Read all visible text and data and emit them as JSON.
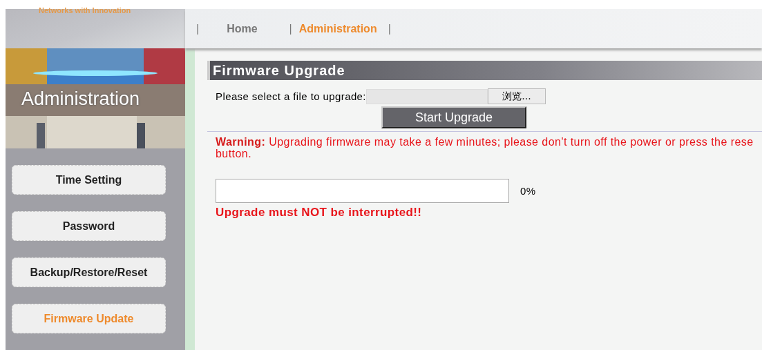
{
  "logo": {
    "tagline": "Networks with Innovation"
  },
  "nav": {
    "separator": "|",
    "items": [
      {
        "label": "Home",
        "selected": false
      },
      {
        "label": "Administration",
        "selected": true
      }
    ]
  },
  "sidebar": {
    "banner_title": "Administration",
    "items": [
      {
        "label": "Time Setting",
        "selected": false
      },
      {
        "label": "Password",
        "selected": false
      },
      {
        "label": "Backup/Restore/Reset",
        "selected": false
      },
      {
        "label": "Firmware Update",
        "selected": true
      }
    ]
  },
  "panel": {
    "title": "Firmware Upgrade",
    "file_label": "Please select a file to upgrade:",
    "browse_button": "浏览...",
    "start_button": "Start Upgrade",
    "warning_lines": [
      "**Warning:** Upgrading firmware may take a few minutes; please don't turn off the power or press the rese",
      "button."
    ],
    "progress": {
      "level": 0,
      "reading": "0%"
    },
    "notice": "Upgrade must NOT be interrupted!!"
  }
}
